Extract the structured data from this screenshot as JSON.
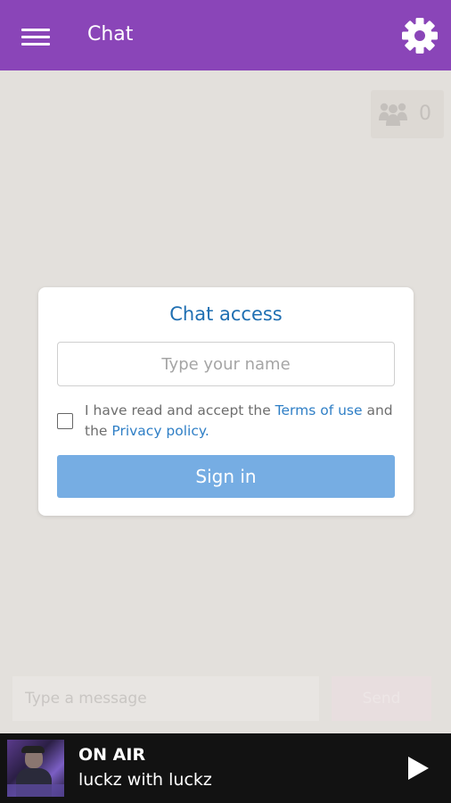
{
  "appbar": {
    "title": "Chat",
    "menu_icon": "hamburger-menu-icon",
    "settings_icon": "gear-icon",
    "color": "#8a45b8"
  },
  "users": {
    "icon": "users-group-icon",
    "count": "0"
  },
  "access_card": {
    "title": "Chat access",
    "name_placeholder": "Type your name",
    "terms_text_1": "I have read and accept the ",
    "terms_link": "Terms of use",
    "terms_text_2": " and the ",
    "privacy_link": "Privacy policy",
    "terms_text_3": ".",
    "sign_in_label": "Sign in",
    "sign_in_color": "#76ade3",
    "title_color": "#1f6fb2"
  },
  "composer": {
    "message_placeholder": "Type a message",
    "send_label": "Send"
  },
  "player": {
    "status": "ON AIR",
    "title": "luckz with luckz",
    "play_icon": "play-icon"
  }
}
